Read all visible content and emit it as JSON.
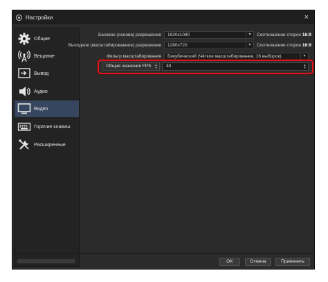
{
  "window": {
    "title": "Настройки",
    "close_glyph": "×"
  },
  "sidebar": {
    "items": [
      {
        "label": "Общие",
        "icon": "gear-icon"
      },
      {
        "label": "Вещание",
        "icon": "broadcast-icon"
      },
      {
        "label": "Вывод",
        "icon": "output-icon"
      },
      {
        "label": "Аудио",
        "icon": "speaker-icon"
      },
      {
        "label": "Видео",
        "icon": "monitor-icon",
        "active": true
      },
      {
        "label": "Горячие клавиш",
        "icon": "keyboard-icon"
      },
      {
        "label": "Расширенные",
        "icon": "tools-icon"
      }
    ]
  },
  "video": {
    "base_resolution": {
      "label": "Базовое (основа) разрешение",
      "value": "1920x1080",
      "aspect_label": "Соотношение сторон",
      "aspect_value": "16:9"
    },
    "output_resolution": {
      "label": "Выходное (масштабированное) разрешение",
      "value": "1280x720",
      "aspect_label": "Соотношение сторон",
      "aspect_value": "16:9"
    },
    "scale_filter": {
      "label": "Фильтр масштабирования",
      "value": "Бикубический (Чёткое масштабирование, 16 выборок)"
    },
    "fps": {
      "type_value": "Общие значения FPS",
      "value": "30"
    }
  },
  "buttons": {
    "ok": "OK",
    "cancel": "Отмена",
    "apply": "Применить"
  },
  "colors": {
    "highlight": "#e0141e",
    "active_item": "#37465f"
  }
}
